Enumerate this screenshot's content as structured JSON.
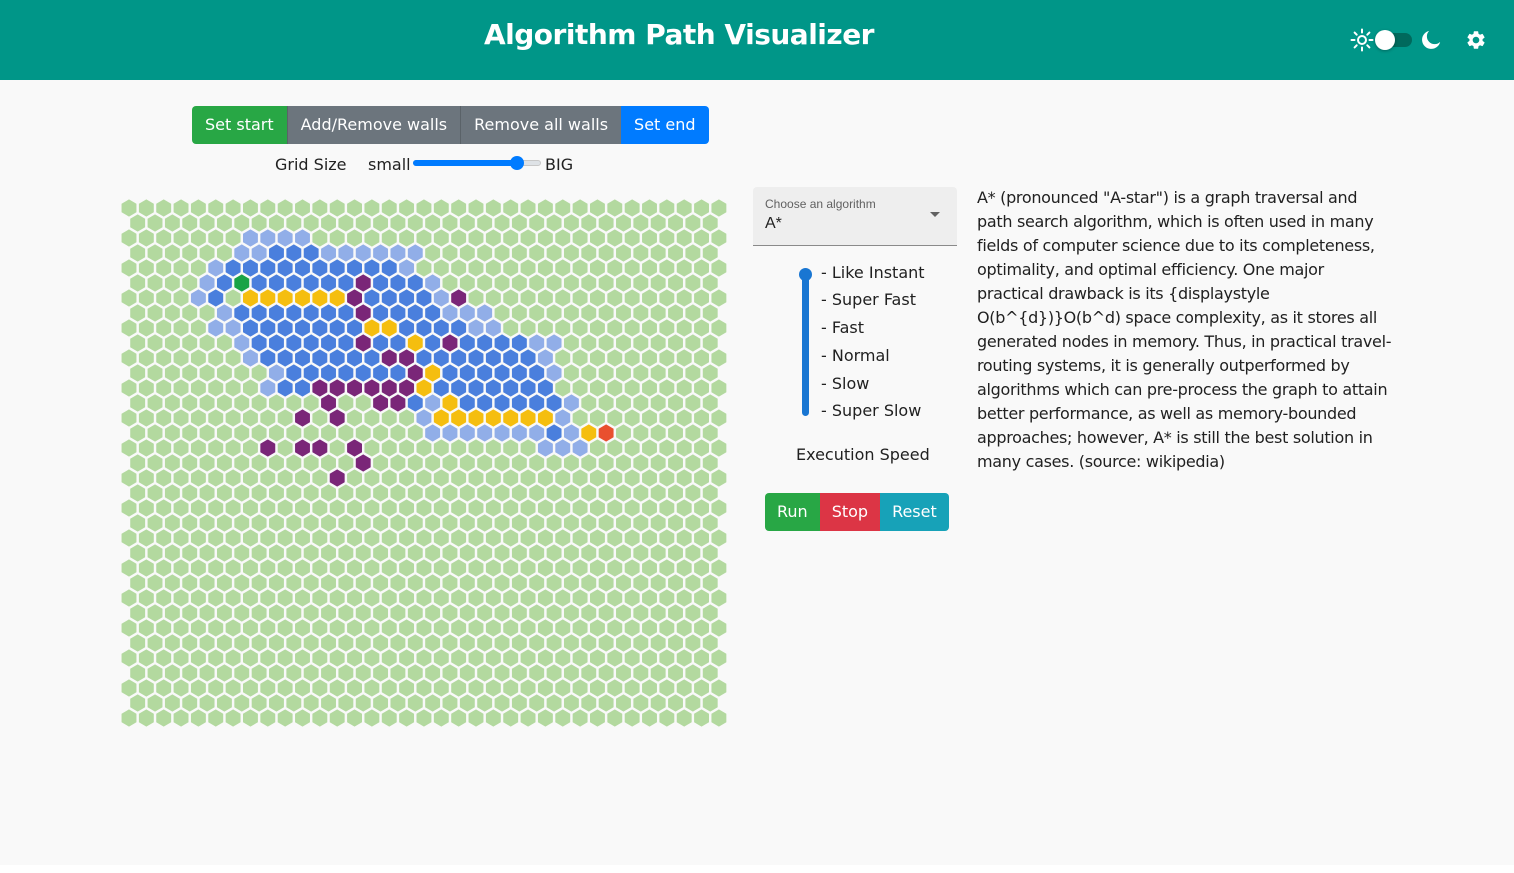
{
  "header": {
    "title": "Algorithm Path Visualizer",
    "icons": [
      "sun-icon",
      "theme-toggle",
      "moon-icon",
      "gear-icon"
    ],
    "dark_mode": false
  },
  "toolbar": {
    "set_start": "Set start",
    "add_remove_walls": "Add/Remove walls",
    "remove_all_walls": "Remove all walls",
    "set_end": "Set end"
  },
  "grid_size": {
    "label": "Grid Size",
    "min_label": "small",
    "max_label": "BIG",
    "value_fraction": 0.81
  },
  "algorithm_select": {
    "label": "Choose an algorithm",
    "value": "A*"
  },
  "speed": {
    "options": [
      "- Like Instant",
      "- Super Fast",
      "- Fast",
      "- Normal",
      "- Slow",
      "- Super Slow"
    ],
    "selected": "- Like Instant",
    "label": "Execution Speed"
  },
  "controls": {
    "run": "Run",
    "stop": "Stop",
    "reset": "Reset"
  },
  "description": "A* (pronounced \"A-star\") is a graph traversal and path search algorithm, which is often used in many fields of computer science due to its completeness, optimality, and optimal efficiency. One major practical drawback is its {displaystyle O(b^{d})}O(b^d) space complexity, as it stores all generated nodes in memory. Thus, in practical travel-routing systems, it is generally outperformed by algorithms which can pre-process the graph to attain better performance, as well as memory-bounded approaches; however, A* is still the best solution in many cases. (source: wikipedia)",
  "colors": {
    "header": "#009688",
    "empty_cell": "#b3d99f",
    "visited": "#4a7fdd",
    "frontier": "#91aee8",
    "path": "#f5be0f",
    "wall": "#7a2678",
    "start": "#1aa346",
    "end": "#e9502f"
  },
  "hex_grid": {
    "columns": 35,
    "rows": 35,
    "cells": {
      "start": [
        [
          5,
          6
        ]
      ],
      "end": [
        [
          15,
          27
        ]
      ],
      "path": [
        [
          6,
          7
        ],
        [
          6,
          8
        ],
        [
          6,
          9
        ],
        [
          6,
          10
        ],
        [
          6,
          11
        ],
        [
          6,
          12
        ],
        [
          7,
          13
        ],
        [
          8,
          14
        ],
        [
          8,
          15
        ],
        [
          9,
          16
        ],
        [
          10,
          16
        ],
        [
          11,
          17
        ],
        [
          12,
          17
        ],
        [
          13,
          18
        ],
        [
          14,
          18
        ],
        [
          14,
          19
        ],
        [
          14,
          20
        ],
        [
          14,
          21
        ],
        [
          14,
          22
        ],
        [
          14,
          23
        ],
        [
          14,
          24
        ],
        [
          15,
          26
        ]
      ],
      "wall": [
        [
          5,
          13
        ],
        [
          6,
          13
        ],
        [
          6,
          19
        ],
        [
          7,
          13
        ],
        [
          9,
          13
        ],
        [
          9,
          18
        ],
        [
          10,
          15
        ],
        [
          10,
          16
        ],
        [
          11,
          16
        ],
        [
          12,
          11
        ],
        [
          12,
          12
        ],
        [
          12,
          13
        ],
        [
          12,
          14
        ],
        [
          12,
          15
        ],
        [
          12,
          16
        ],
        [
          13,
          11
        ],
        [
          13,
          14
        ],
        [
          13,
          15
        ],
        [
          14,
          10
        ],
        [
          14,
          12
        ],
        [
          16,
          8
        ],
        [
          16,
          10
        ],
        [
          16,
          11
        ],
        [
          16,
          13
        ],
        [
          17,
          13
        ],
        [
          18,
          12
        ]
      ],
      "visited": [
        [
          3,
          8
        ],
        [
          3,
          9
        ],
        [
          3,
          10
        ],
        [
          4,
          6
        ],
        [
          4,
          7
        ],
        [
          4,
          8
        ],
        [
          4,
          9
        ],
        [
          4,
          10
        ],
        [
          4,
          11
        ],
        [
          4,
          12
        ],
        [
          4,
          13
        ],
        [
          4,
          14
        ],
        [
          4,
          15
        ],
        [
          5,
          5
        ],
        [
          5,
          7
        ],
        [
          5,
          8
        ],
        [
          5,
          9
        ],
        [
          5,
          10
        ],
        [
          5,
          11
        ],
        [
          5,
          12
        ],
        [
          5,
          14
        ],
        [
          5,
          15
        ],
        [
          5,
          16
        ],
        [
          6,
          5
        ],
        [
          6,
          14
        ],
        [
          6,
          15
        ],
        [
          6,
          16
        ],
        [
          6,
          17
        ],
        [
          7,
          6
        ],
        [
          7,
          7
        ],
        [
          7,
          8
        ],
        [
          7,
          9
        ],
        [
          7,
          10
        ],
        [
          7,
          11
        ],
        [
          7,
          12
        ],
        [
          7,
          14
        ],
        [
          7,
          15
        ],
        [
          7,
          16
        ],
        [
          7,
          17
        ],
        [
          8,
          7
        ],
        [
          8,
          8
        ],
        [
          8,
          9
        ],
        [
          8,
          10
        ],
        [
          8,
          11
        ],
        [
          8,
          12
        ],
        [
          8,
          13
        ],
        [
          8,
          16
        ],
        [
          8,
          17
        ],
        [
          8,
          18
        ],
        [
          8,
          19
        ],
        [
          9,
          7
        ],
        [
          9,
          8
        ],
        [
          9,
          9
        ],
        [
          9,
          10
        ],
        [
          9,
          11
        ],
        [
          9,
          12
        ],
        [
          9,
          14
        ],
        [
          9,
          15
        ],
        [
          9,
          17
        ],
        [
          9,
          19
        ],
        [
          9,
          20
        ],
        [
          9,
          21
        ],
        [
          9,
          22
        ],
        [
          10,
          8
        ],
        [
          10,
          9
        ],
        [
          10,
          10
        ],
        [
          10,
          11
        ],
        [
          10,
          12
        ],
        [
          10,
          13
        ],
        [
          10,
          14
        ],
        [
          10,
          17
        ],
        [
          10,
          18
        ],
        [
          10,
          19
        ],
        [
          10,
          20
        ],
        [
          10,
          21
        ],
        [
          10,
          22
        ],
        [
          10,
          23
        ],
        [
          11,
          9
        ],
        [
          11,
          10
        ],
        [
          11,
          11
        ],
        [
          11,
          12
        ],
        [
          11,
          13
        ],
        [
          11,
          14
        ],
        [
          11,
          15
        ],
        [
          11,
          18
        ],
        [
          11,
          19
        ],
        [
          11,
          20
        ],
        [
          11,
          21
        ],
        [
          11,
          22
        ],
        [
          11,
          23
        ],
        [
          12,
          9
        ],
        [
          12,
          10
        ],
        [
          12,
          18
        ],
        [
          12,
          19
        ],
        [
          12,
          20
        ],
        [
          12,
          21
        ],
        [
          12,
          22
        ],
        [
          12,
          23
        ],
        [
          12,
          24
        ],
        [
          13,
          16
        ],
        [
          13,
          19
        ],
        [
          13,
          20
        ],
        [
          13,
          21
        ],
        [
          13,
          22
        ],
        [
          13,
          23
        ],
        [
          13,
          24
        ],
        [
          15,
          24
        ]
      ],
      "frontier": [
        [
          2,
          7
        ],
        [
          2,
          8
        ],
        [
          2,
          9
        ],
        [
          2,
          10
        ],
        [
          3,
          6
        ],
        [
          3,
          7
        ],
        [
          3,
          11
        ],
        [
          3,
          12
        ],
        [
          3,
          13
        ],
        [
          3,
          14
        ],
        [
          3,
          15
        ],
        [
          3,
          16
        ],
        [
          4,
          5
        ],
        [
          4,
          16
        ],
        [
          5,
          4
        ],
        [
          5,
          17
        ],
        [
          6,
          4
        ],
        [
          6,
          18
        ],
        [
          7,
          5
        ],
        [
          7,
          18
        ],
        [
          7,
          19
        ],
        [
          7,
          20
        ],
        [
          8,
          5
        ],
        [
          8,
          6
        ],
        [
          8,
          20
        ],
        [
          8,
          21
        ],
        [
          9,
          6
        ],
        [
          9,
          23
        ],
        [
          9,
          24
        ],
        [
          10,
          7
        ],
        [
          10,
          24
        ],
        [
          11,
          8
        ],
        [
          11,
          24
        ],
        [
          12,
          8
        ],
        [
          13,
          17
        ],
        [
          13,
          25
        ],
        [
          14,
          17
        ],
        [
          14,
          25
        ],
        [
          15,
          17
        ],
        [
          15,
          18
        ],
        [
          15,
          19
        ],
        [
          15,
          20
        ],
        [
          15,
          21
        ],
        [
          15,
          22
        ],
        [
          15,
          23
        ],
        [
          15,
          25
        ],
        [
          16,
          24
        ],
        [
          16,
          25
        ],
        [
          16,
          26
        ]
      ]
    }
  }
}
